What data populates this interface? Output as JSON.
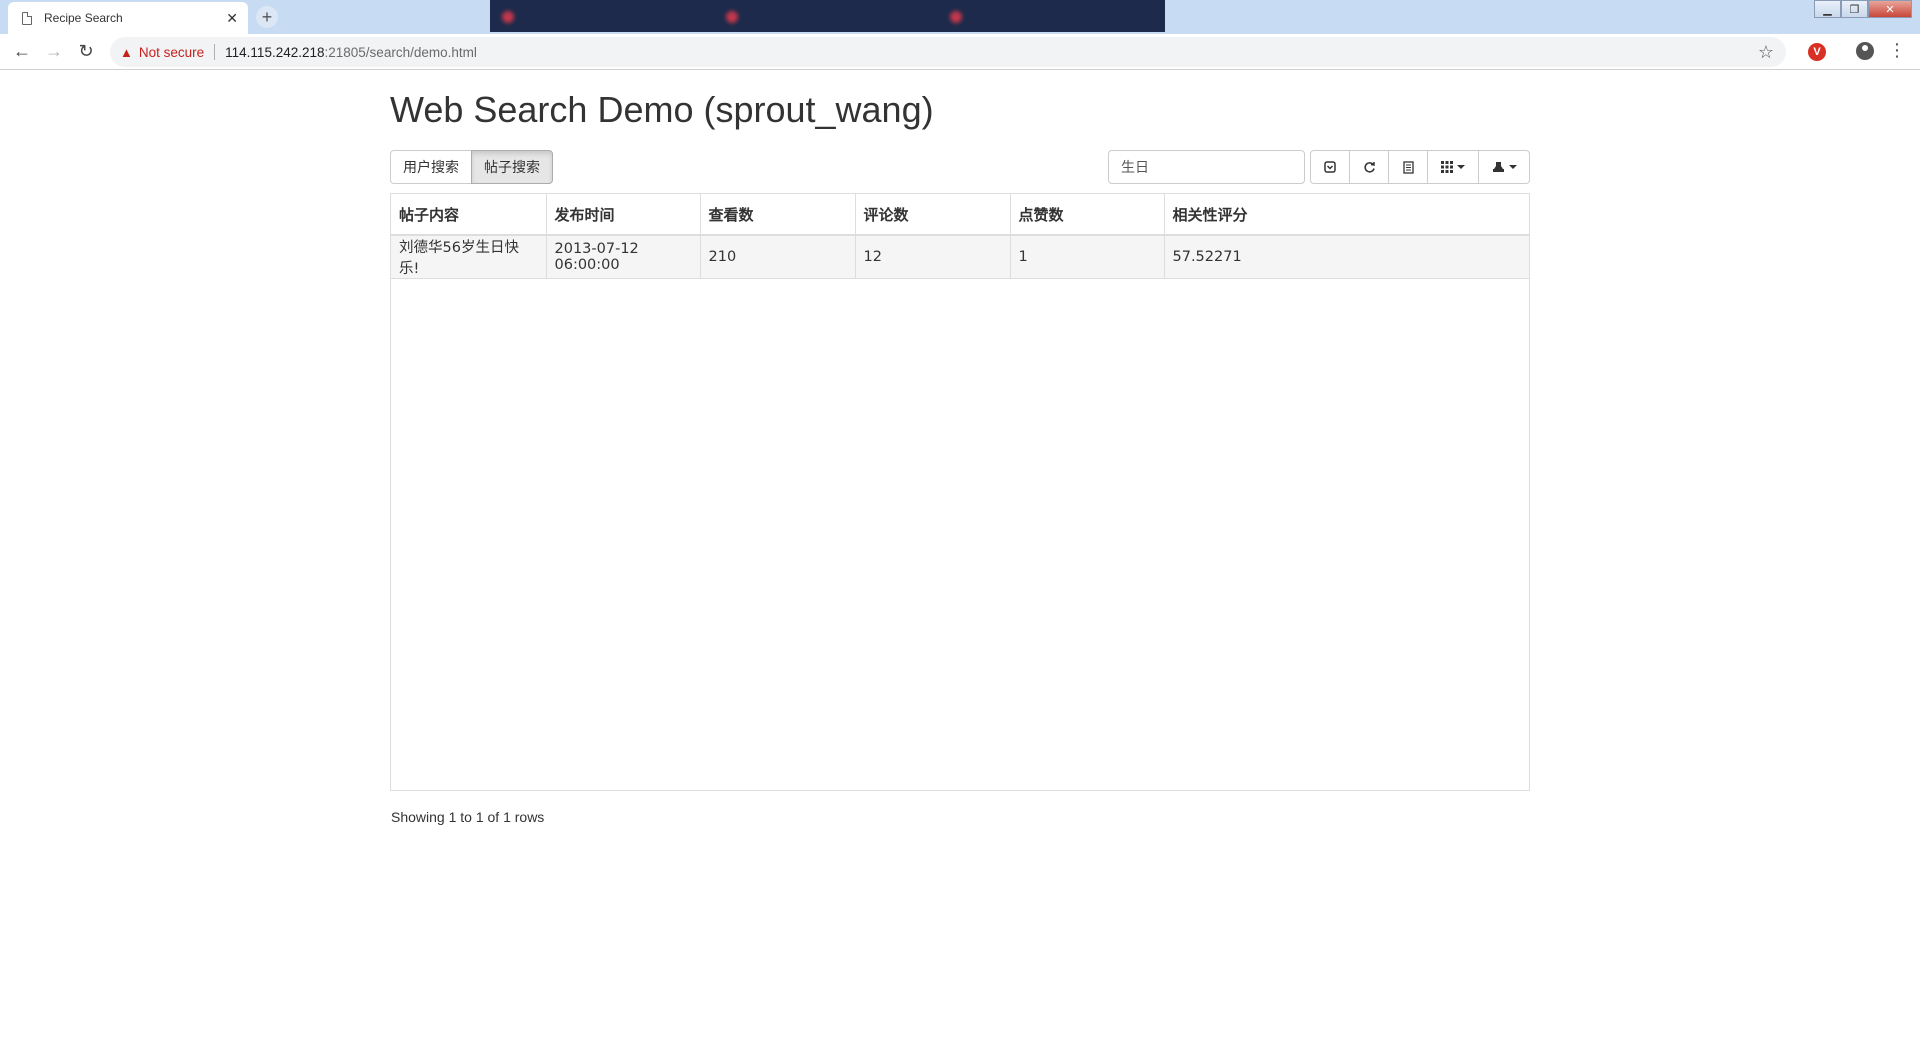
{
  "browser": {
    "active_tab_title": "Recipe Search",
    "not_secure_label": "Not secure",
    "url_host": "114.115.242.218",
    "url_path": ":21805/search/demo.html"
  },
  "page": {
    "title": "Web Search Demo (sprout_wang)",
    "mode_buttons": [
      "用户搜索",
      "帖子搜索"
    ],
    "active_mode": "帖子搜索",
    "search_value": "生日"
  },
  "table": {
    "columns": [
      "帖子内容",
      "发布时间",
      "查看数",
      "评论数",
      "点赞数",
      "相关性评分"
    ],
    "rows": [
      [
        "刘德华56岁生日快乐!",
        "2013-07-12 06:00:00",
        "210",
        "12",
        "1",
        "57.52271"
      ]
    ]
  },
  "footer": {
    "pagination_info": "Showing 1 to 1 of 1 rows"
  },
  "icons": [
    "new-tab-icon",
    "back-icon",
    "forward-icon",
    "reload-icon",
    "warning-icon",
    "star-icon",
    "extension-icon",
    "profile-icon",
    "menu-icon",
    "toggle-icon",
    "refresh-icon",
    "card-view-icon",
    "columns-icon",
    "export-icon"
  ]
}
